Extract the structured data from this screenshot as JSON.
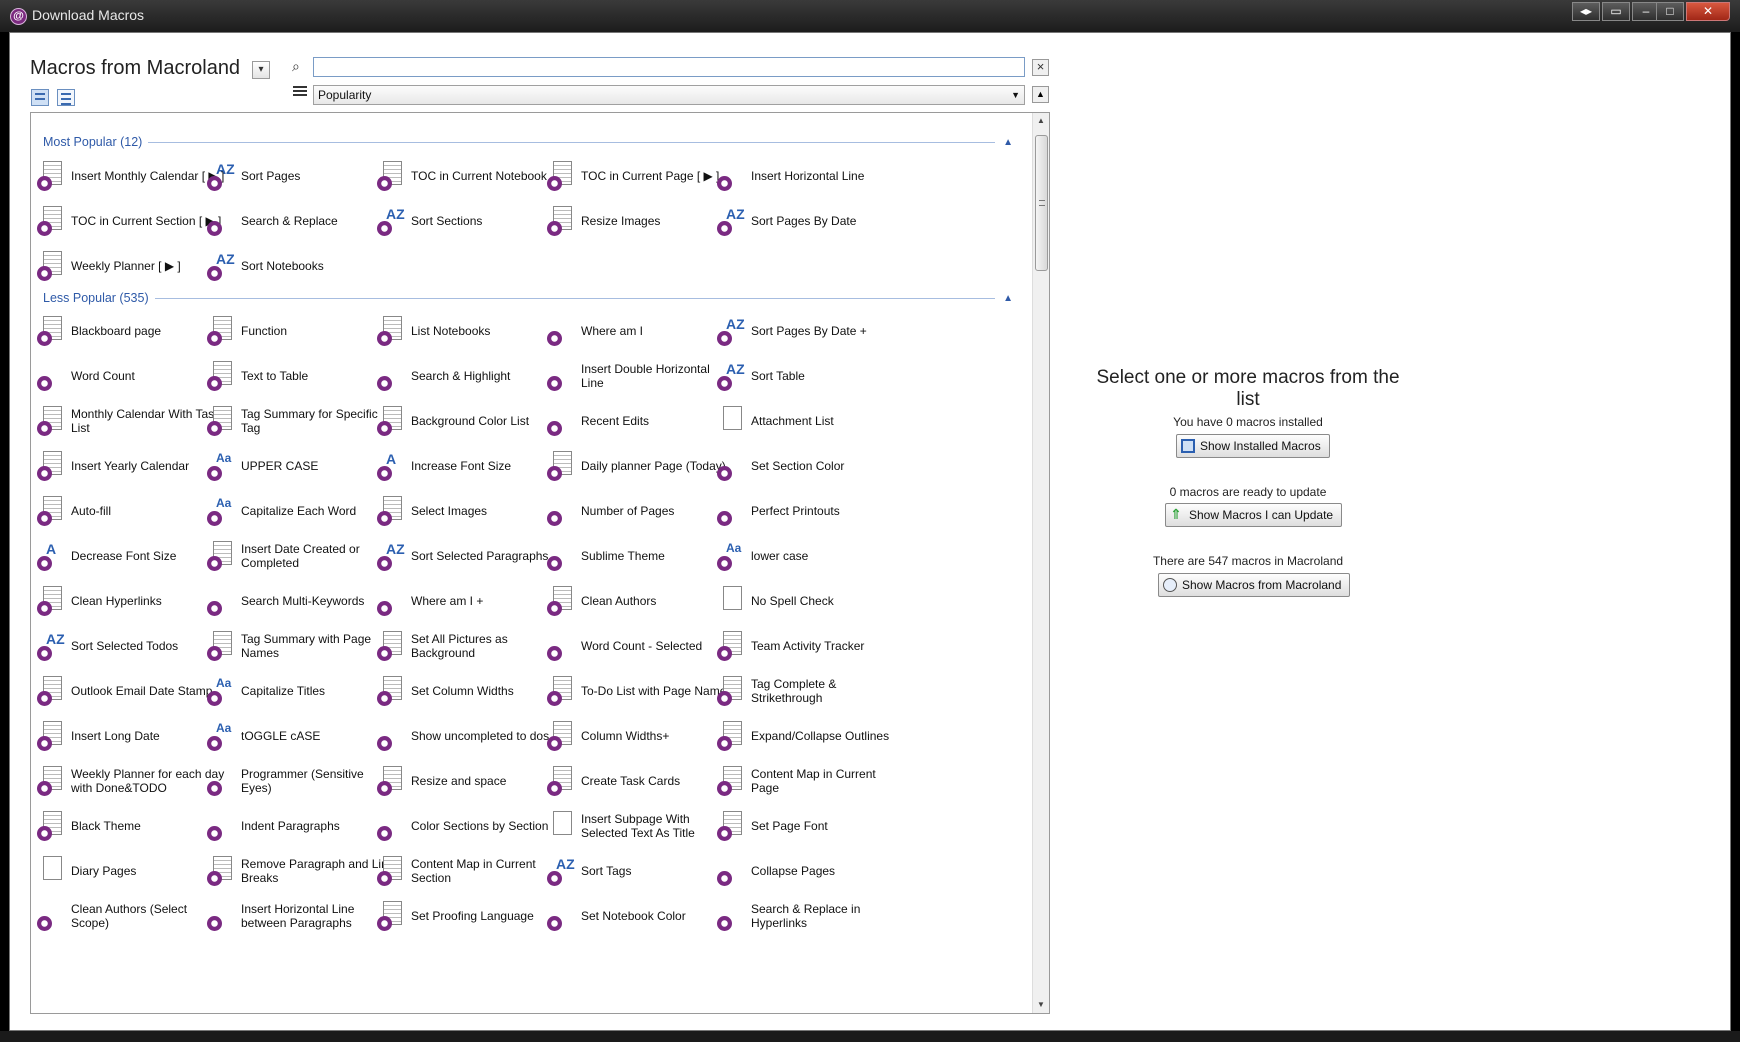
{
  "window": {
    "title": "Download Macros",
    "app_icon": "onetastic-icon"
  },
  "header": {
    "title": "Macros from Macroland",
    "search_placeholder": "",
    "sort_value": "Popularity"
  },
  "groups": [
    {
      "title": "Most Popular (12)",
      "items": [
        {
          "label": "Insert Monthly Calendar [ ▶ ]",
          "icon": "calendar-gear-icon"
        },
        {
          "label": "Sort Pages",
          "icon": "sort-az-icon"
        },
        {
          "label": "TOC in Current Notebook",
          "icon": "document-gear-icon"
        },
        {
          "label": "TOC in Current Page [ ▶ ]",
          "icon": "document-gear-icon"
        },
        {
          "label": "Insert Horizontal Line",
          "icon": "horizontal-line-icon"
        },
        {
          "label": "TOC in Current Section [ ▶ ]",
          "icon": "document-gear-icon"
        },
        {
          "label": "Search & Replace",
          "icon": "binoculars-icon"
        },
        {
          "label": "Sort Sections",
          "icon": "sort-az-icon"
        },
        {
          "label": "Resize Images",
          "icon": "image-gear-icon"
        },
        {
          "label": "Sort Pages By Date",
          "icon": "sort-az-icon"
        },
        {
          "label": "Weekly Planner [ ▶ ]",
          "icon": "calendar-gear-icon"
        },
        {
          "label": "Sort Notebooks",
          "icon": "sort-az-icon"
        }
      ]
    },
    {
      "title": "Less Popular (535)",
      "items": [
        {
          "label": "Blackboard page",
          "icon": "page-gear-icon"
        },
        {
          "label": "Function",
          "icon": "table-gear-icon"
        },
        {
          "label": "List Notebooks",
          "icon": "document-gear-icon"
        },
        {
          "label": "Where am I",
          "icon": "gear-icon"
        },
        {
          "label": "Sort Pages By Date +",
          "icon": "sort-az-icon"
        },
        {
          "label": "Word Count",
          "icon": "gear-icon"
        },
        {
          "label": "Text to Table",
          "icon": "table-gear-icon"
        },
        {
          "label": "Search & Highlight",
          "icon": "binoculars-icon"
        },
        {
          "label": "Insert Double Horizontal Line",
          "icon": "horizontal-line-icon"
        },
        {
          "label": "Sort Table",
          "icon": "sort-az-icon"
        },
        {
          "label": "Monthly Calendar With Task List",
          "icon": "calendar-gear-icon"
        },
        {
          "label": "Tag Summary for Specific Tag",
          "icon": "checkbox-gear-icon"
        },
        {
          "label": "Background Color List",
          "icon": "page-gear-icon"
        },
        {
          "label": "Recent Edits",
          "icon": "link-gear-icon"
        },
        {
          "label": "Attachment List",
          "icon": "paperclip-icon"
        },
        {
          "label": "Insert Yearly Calendar",
          "icon": "calendar-gear-icon"
        },
        {
          "label": "UPPER CASE",
          "icon": "case-icon"
        },
        {
          "label": "Increase Font Size",
          "icon": "font-size-icon"
        },
        {
          "label": "Daily planner Page (Today)",
          "icon": "calendar-gear-icon"
        },
        {
          "label": "Set Section Color",
          "icon": "color-gear-icon"
        },
        {
          "label": "Auto-fill",
          "icon": "table-gear-icon"
        },
        {
          "label": "Capitalize Each Word",
          "icon": "case-icon"
        },
        {
          "label": "Select Images",
          "icon": "image-gear-icon"
        },
        {
          "label": "Number of Pages",
          "icon": "gear-icon"
        },
        {
          "label": "Perfect Printouts",
          "icon": "gear-icon"
        },
        {
          "label": "Decrease Font Size",
          "icon": "font-size-icon"
        },
        {
          "label": "Insert Date Created or Completed",
          "icon": "checkbox-gear-icon"
        },
        {
          "label": "Sort Selected Paragraphs",
          "icon": "sort-az-icon"
        },
        {
          "label": "Sublime Theme",
          "icon": "binoculars-icon"
        },
        {
          "label": "lower case",
          "icon": "case-icon"
        },
        {
          "label": "Clean Hyperlinks",
          "icon": "document-gear-icon"
        },
        {
          "label": "Search Multi-Keywords",
          "icon": "binoculars-icon"
        },
        {
          "label": "Where am I +",
          "icon": "gear-icon"
        },
        {
          "label": "Clean Authors",
          "icon": "document-gear-icon"
        },
        {
          "label": "No Spell Check",
          "icon": "spell-check-icon"
        },
        {
          "label": "Sort Selected Todos",
          "icon": "sort-az-icon"
        },
        {
          "label": "Tag Summary with Page Names",
          "icon": "checkbox-gear-icon"
        },
        {
          "label": "Set All Pictures as Background",
          "icon": "image-gear-icon"
        },
        {
          "label": "Word Count - Selected",
          "icon": "gear-icon"
        },
        {
          "label": "Team Activity Tracker",
          "icon": "calendar-gear-icon"
        },
        {
          "label": "Outlook Email Date Stamp",
          "icon": "envelope-gear-icon"
        },
        {
          "label": "Capitalize Titles",
          "icon": "case-icon"
        },
        {
          "label": "Set Column Widths",
          "icon": "table-gear-icon"
        },
        {
          "label": "To-Do List with Page Names",
          "icon": "checkbox-gear-icon"
        },
        {
          "label": "Tag Complete & Strikethrough",
          "icon": "checkbox-gear-icon"
        },
        {
          "label": "Insert Long Date",
          "icon": "calendar-gear-icon"
        },
        {
          "label": "tOGGLE cASE",
          "icon": "case-icon"
        },
        {
          "label": "Show uncompleted to dos",
          "icon": "binoculars-icon"
        },
        {
          "label": "Column Widths+",
          "icon": "table-gear-icon"
        },
        {
          "label": "Expand/Collapse Outlines",
          "icon": "outline-icon"
        },
        {
          "label": "Weekly Planner for each day with Done&TODO",
          "icon": "calendar-gear-icon"
        },
        {
          "label": "Programmer (Sensitive Eyes)",
          "icon": "gear-icon"
        },
        {
          "label": "Resize and space",
          "icon": "image-gear-icon"
        },
        {
          "label": "Create Task Cards",
          "icon": "document-gear-icon"
        },
        {
          "label": "Content Map in Current Page",
          "icon": "document-gear-icon"
        },
        {
          "label": "Black Theme",
          "icon": "page-gear-icon"
        },
        {
          "label": "Indent Paragraphs",
          "icon": "font-color-icon"
        },
        {
          "label": "Color Sections by Section",
          "icon": "color-gear-icon"
        },
        {
          "label": "Insert Subpage With Selected Text As Title",
          "icon": "blank-page-icon"
        },
        {
          "label": "Set Page Font",
          "icon": "document-gear-icon"
        },
        {
          "label": "Diary Pages",
          "icon": "blank-page-icon"
        },
        {
          "label": "Remove Paragraph and Line Breaks",
          "icon": "document-gear-icon"
        },
        {
          "label": "Content Map in Current Section",
          "icon": "document-gear-icon"
        },
        {
          "label": "Sort Tags",
          "icon": "sort-az-icon"
        },
        {
          "label": "Collapse Pages",
          "icon": "gear-icon"
        },
        {
          "label": "Clean Authors (Select Scope)",
          "icon": "gear-icon"
        },
        {
          "label": "Insert Horizontal Line between Paragraphs",
          "icon": "horizontal-line-icon"
        },
        {
          "label": "Set Proofing Language",
          "icon": "document-gear-icon"
        },
        {
          "label": "Set Notebook Color",
          "icon": "color-gear-icon"
        },
        {
          "label": "Search & Replace in Hyperlinks",
          "icon": "binoculars-icon"
        }
      ]
    }
  ],
  "right_panel": {
    "title": "Select one or more macros from the list",
    "installed_text": "You have 0 macros installed",
    "installed_button": "Show Installed Macros",
    "update_text": "0 macros are ready to update",
    "update_button": "Show Macros I can Update",
    "macroland_text": "There are 547 macros in Macroland",
    "macroland_button": "Show Macros from Macroland"
  },
  "colors": {
    "accent": "#2f5aa8",
    "icon_purple": "#7a2a82",
    "update_green": "#2fa33a"
  }
}
